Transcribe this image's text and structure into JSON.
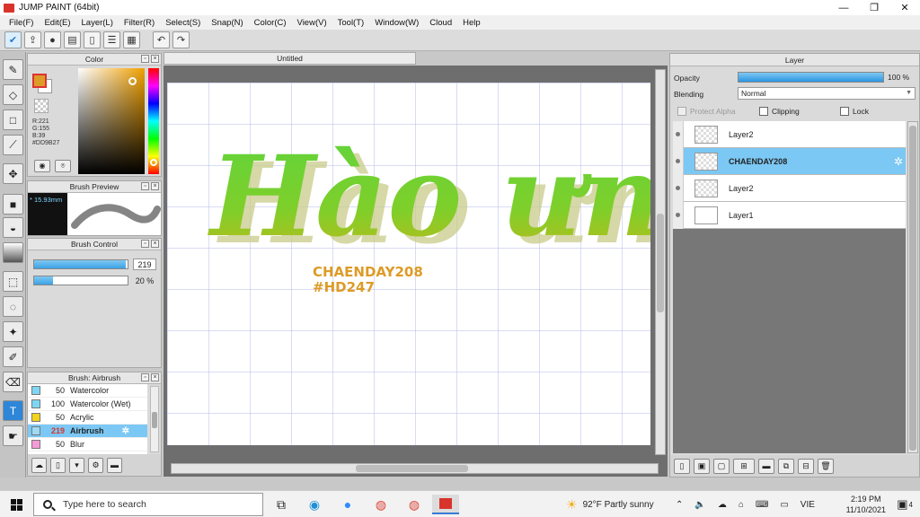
{
  "window": {
    "title": "JUMP PAINT (64bit)",
    "minimize": "—",
    "restore": "❐",
    "close": "✕"
  },
  "menu": [
    "File(F)",
    "Edit(E)",
    "Layer(L)",
    "Filter(R)",
    "Select(S)",
    "Snap(N)",
    "Color(C)",
    "View(V)",
    "Tool(T)",
    "Window(W)",
    "Cloud",
    "Help"
  ],
  "toolbar_icons": [
    "check-icon",
    "share-icon",
    "comment-icon",
    "message-icon",
    "document-icon",
    "list-icon",
    "grid-icon",
    "undo-icon",
    "redo-icon"
  ],
  "tools": [
    "pen-icon",
    "eraser-icon",
    "square-icon",
    "line-icon",
    "move-icon",
    "fill-rect-icon",
    "bucket-icon",
    "gradient-icon",
    "rect-select-icon",
    "lasso-icon",
    "magic-wand-icon",
    "select-pen-icon",
    "select-eraser-icon",
    "text-icon",
    "hand-icon"
  ],
  "color_panel": {
    "title": "Color",
    "r": "R:221",
    "g": "G:155",
    "b": "B:39",
    "hex": "#DD9B27",
    "main_color": "#dd9b27"
  },
  "brush_preview": {
    "title": "Brush Preview",
    "size": "* 15.93mm"
  },
  "brush_control": {
    "title": "Brush Control",
    "size_value": "219",
    "size_fraction": 0.98,
    "opacity_value": "20 %",
    "opacity_fraction": 0.2
  },
  "brush_list": {
    "title": "Brush: Airbrush",
    "items": [
      {
        "num": "50",
        "name": "Watercolor",
        "color": "#7fd6f4",
        "selected": false
      },
      {
        "num": "100",
        "name": "Watercolor (Wet)",
        "color": "#7fd6f4",
        "selected": false
      },
      {
        "num": "50",
        "name": "Acrylic",
        "color": "#f2d31a",
        "selected": false
      },
      {
        "num": "219",
        "name": "Airbrush",
        "color": "#9edaf6",
        "selected": true
      },
      {
        "num": "50",
        "name": "Blur",
        "color": "#f59ad8",
        "selected": false
      }
    ]
  },
  "canvas": {
    "tab": "Untitled",
    "main_text": "Hào ưng",
    "sub_line1": "CHAENDAY208",
    "sub_line2": "#HD247",
    "text_color": "#dd9b27"
  },
  "layer_panel": {
    "title": "Layer",
    "opacity_label": "Opacity",
    "opacity_value": "100 %",
    "blending_label": "Blending",
    "blending_value": "Normal",
    "protect_alpha": "Protect Alpha",
    "clipping": "Clipping",
    "lock": "Lock",
    "layers": [
      {
        "name": "Layer2",
        "selected": false,
        "thumb": "checker"
      },
      {
        "name": "CHAENDAY208",
        "selected": true,
        "thumb": "checker"
      },
      {
        "name": "Layer2",
        "selected": false,
        "thumb": "checker"
      },
      {
        "name": "Layer1",
        "selected": false,
        "thumb": "plain"
      }
    ]
  },
  "taskbar": {
    "search_placeholder": "Type here to search",
    "weather": "92°F  Partly sunny",
    "lang": "VIE",
    "time": "2:19 PM",
    "date": "11/10/2021",
    "notifications": "4"
  }
}
